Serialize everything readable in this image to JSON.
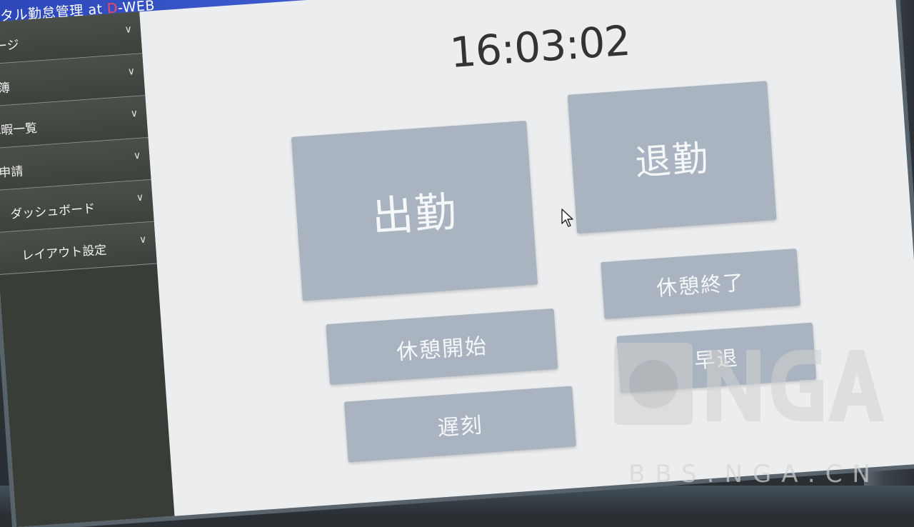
{
  "app": {
    "title_prefix": "ジタル勤怠管理 at ",
    "title_brand_d": "D",
    "title_brand_rest": "-WEB"
  },
  "sidebar": {
    "items": [
      {
        "label": "ページ"
      },
      {
        "label": "勤簿"
      },
      {
        "label": "休暇一覧"
      },
      {
        "label": "申請"
      },
      {
        "label": "ダッシュボード"
      },
      {
        "label": "レイアウト設定"
      }
    ]
  },
  "main": {
    "clock": "16:03:02",
    "buttons": {
      "clock_in": "出勤",
      "clock_out": "退勤",
      "break_start": "休憩開始",
      "break_end": "休憩終了",
      "late": "遅刻",
      "early_leave": "早退"
    }
  },
  "watermark": {
    "text": "BBS.NGA.CN"
  }
}
